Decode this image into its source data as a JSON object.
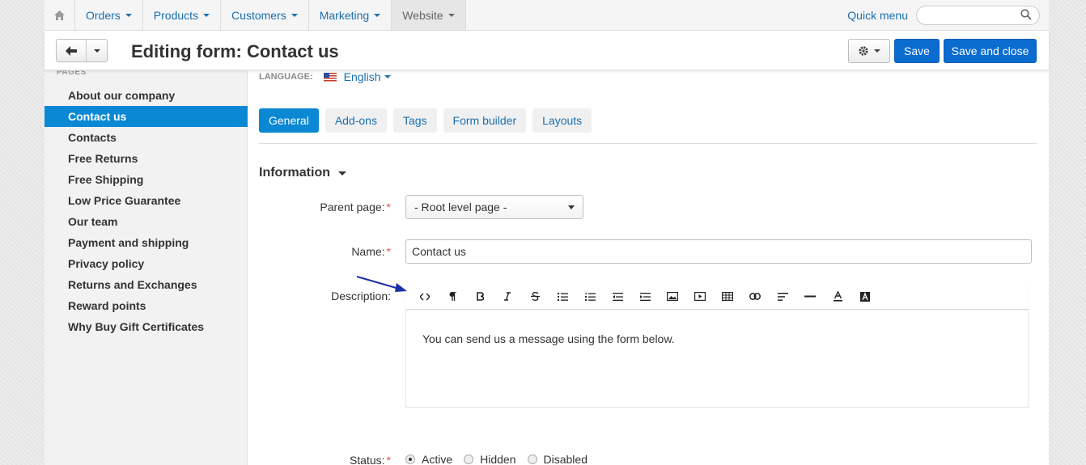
{
  "nav": {
    "menus": [
      {
        "label": "Orders"
      },
      {
        "label": "Products"
      },
      {
        "label": "Customers"
      },
      {
        "label": "Marketing"
      },
      {
        "label": "Website"
      }
    ],
    "quick_menu": "Quick menu",
    "search_placeholder": ""
  },
  "header": {
    "title": "Editing form: Contact us",
    "save_label": "Save",
    "save_close_label": "Save and close"
  },
  "sidebar": {
    "section": "PAGES",
    "items": [
      {
        "label": "About our company"
      },
      {
        "label": "Contact us"
      },
      {
        "label": "Contacts"
      },
      {
        "label": "Free Returns"
      },
      {
        "label": "Free Shipping"
      },
      {
        "label": "Low Price Guarantee"
      },
      {
        "label": "Our team"
      },
      {
        "label": "Payment and shipping"
      },
      {
        "label": "Privacy policy"
      },
      {
        "label": "Returns and Exchanges"
      },
      {
        "label": "Reward points"
      },
      {
        "label": "Why Buy Gift Certificates"
      }
    ]
  },
  "content": {
    "language_label": "LANGUAGE:",
    "language_value": "English",
    "tabs": [
      {
        "label": "General"
      },
      {
        "label": "Add-ons"
      },
      {
        "label": "Tags"
      },
      {
        "label": "Form builder"
      },
      {
        "label": "Layouts"
      }
    ],
    "section_title": "Information",
    "parent_label": "Parent page:",
    "parent_value": "- Root level page -",
    "name_label": "Name:",
    "name_value": "Contact us",
    "description_label": "Description:",
    "description_text": "You can send us a message using the form below.",
    "status_label": "Status:",
    "status_options": [
      {
        "label": "Active"
      },
      {
        "label": "Hidden"
      },
      {
        "label": "Disabled"
      }
    ],
    "required_mark": "*"
  },
  "colors": {
    "accent": "#0b88d4",
    "primary_button": "#0b6cd0",
    "link": "#1a6fb0",
    "annotation_arrow": "#1c2fa6"
  }
}
